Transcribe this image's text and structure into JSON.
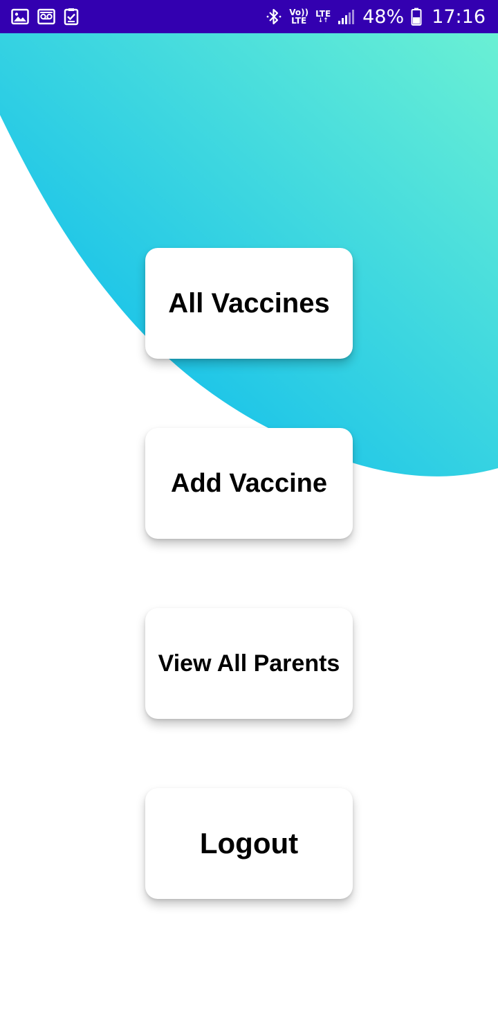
{
  "status_bar": {
    "left_icons": [
      "gallery-icon",
      "voicemail-icon",
      "task-check-icon"
    ],
    "right_icons": [
      "bluetooth-icon",
      "volte-icon",
      "lte-data-icon",
      "signal-icon",
      "battery-icon"
    ],
    "volte_top": "Vo))",
    "volte_bottom": "LTE",
    "lte_label": "LTE",
    "lte_arrows": "↓↑",
    "battery_percent": "48%",
    "time": "17:16",
    "background_color": "#3300b0"
  },
  "background": {
    "wave_gradient_start": "#00b4f0",
    "wave_gradient_end": "#6af0d4"
  },
  "menu": {
    "all_vaccines_label": "All Vaccines",
    "add_vaccine_label": "Add Vaccine",
    "view_all_parents_label": "View All Parents",
    "logout_label": "Logout"
  }
}
